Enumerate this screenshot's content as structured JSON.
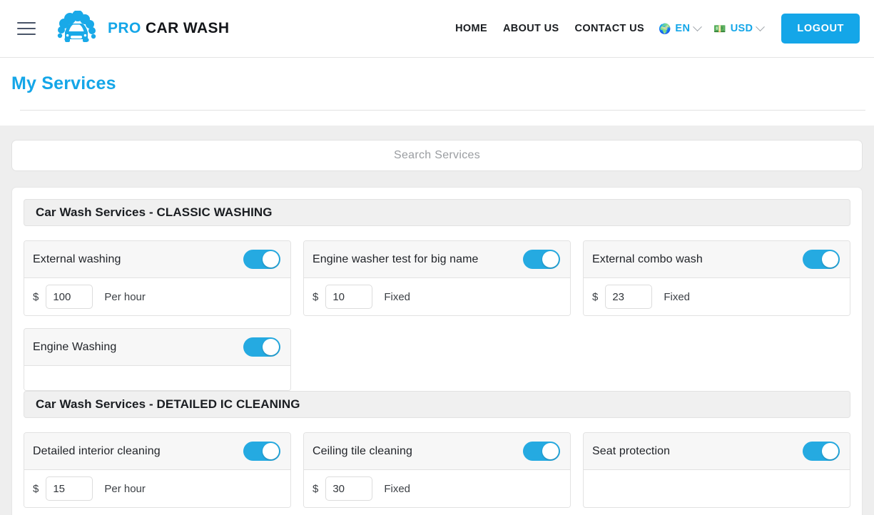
{
  "header": {
    "menu_icon": "hamburger-icon",
    "brand_pro": "PRO",
    "brand_rest": "CAR WASH",
    "nav_links": [
      {
        "label": "HOME"
      },
      {
        "label": "ABOUT US"
      },
      {
        "label": "CONTACT US"
      }
    ],
    "language": {
      "icon": "🌍",
      "label": "EN"
    },
    "currency": {
      "icon": "💵",
      "label": "USD"
    },
    "logout_label": "LOGOUT",
    "accent_color": "#14a6e8"
  },
  "page": {
    "title": "My Services"
  },
  "search": {
    "placeholder": "Search Services",
    "value": ""
  },
  "sections": [
    {
      "title": "Car Wash Services - CLASSIC WASHING",
      "services": [
        {
          "name": "External washing",
          "enabled": true,
          "has_price": true,
          "currency_symbol": "$",
          "price": "100",
          "rate_label": "Per hour"
        },
        {
          "name": "Engine washer test for big name",
          "enabled": true,
          "has_price": true,
          "currency_symbol": "$",
          "price": "10",
          "rate_label": "Fixed"
        },
        {
          "name": "External combo wash",
          "enabled": true,
          "has_price": true,
          "currency_symbol": "$",
          "price": "23",
          "rate_label": "Fixed"
        },
        {
          "name": "Engine Washing",
          "enabled": true,
          "has_price": false,
          "currency_symbol": "",
          "price": "",
          "rate_label": ""
        }
      ]
    },
    {
      "title": "Car Wash Services - DETAILED IC CLEANING",
      "services": [
        {
          "name": "Detailed interior cleaning",
          "enabled": true,
          "has_price": true,
          "currency_symbol": "$",
          "price": "15",
          "rate_label": "Per hour"
        },
        {
          "name": "Ceiling tile cleaning",
          "enabled": true,
          "has_price": true,
          "currency_symbol": "$",
          "price": "30",
          "rate_label": "Fixed"
        },
        {
          "name": "Seat protection",
          "enabled": true,
          "has_price": false,
          "currency_symbol": "",
          "price": "",
          "rate_label": ""
        }
      ]
    }
  ]
}
